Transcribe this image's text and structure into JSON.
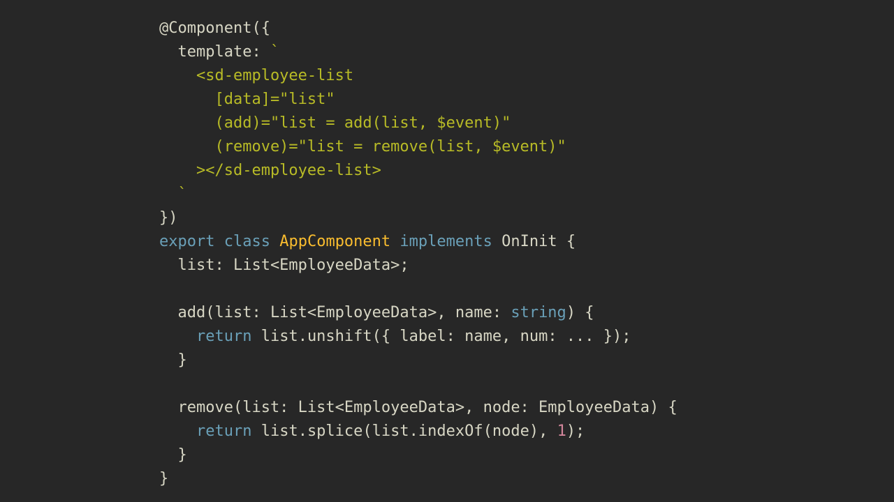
{
  "code": {
    "decorator_name": "@Component",
    "open_paren_brace": "({",
    "prop_template": "template",
    "colon_space": ": ",
    "backtick_open": "`",
    "tpl_line1": "    <sd-employee-list",
    "tpl_line2": "      [data]=\"list\"",
    "tpl_line3": "      (add)=\"list = add(list, $event)\"",
    "tpl_line4": "      (remove)=\"list = remove(list, $event)\"",
    "tpl_line5": "    ></sd-employee-list>",
    "tpl_line6": "  ",
    "backtick_close": "`",
    "close_brace_paren": "})",
    "kw_export": "export",
    "kw_class": "class",
    "class_name": "AppComponent",
    "kw_implements": "implements",
    "interface_name": "OnInit",
    "open_brace": " {",
    "list_field": "  list: List<EmployeeData>;",
    "add_sig_head": "  add(list: List<EmployeeData>, name: ",
    "kw_string": "string",
    "add_sig_tail": ") {",
    "kw_return1": "return",
    "add_body_tail": " list.unshift({ label: name, num: ... });",
    "brace_close1": "  }",
    "remove_sig": "  remove(list: List<EmployeeData>, node: EmployeeData) {",
    "kw_return2": "return",
    "remove_body_tail": " list.splice(list.indexOf(node), ",
    "num_one": "1",
    "remove_body_tail2": ");",
    "brace_close2": "  }",
    "brace_close3": "}",
    "sp1": " ",
    "indent4": "    "
  }
}
